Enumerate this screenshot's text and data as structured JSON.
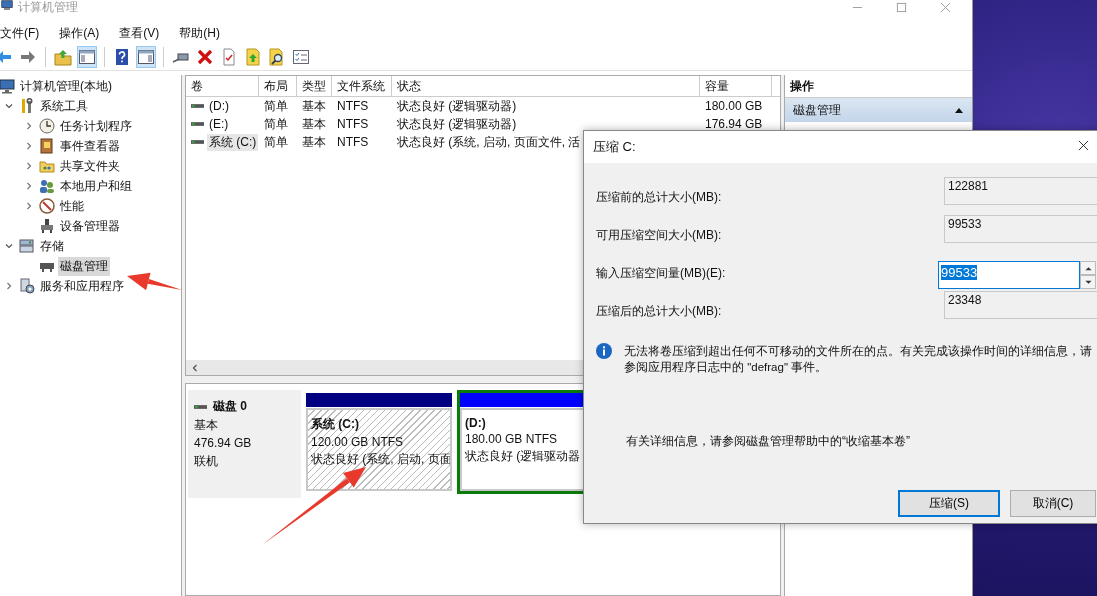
{
  "main_window": {
    "title": "计算机管理"
  },
  "menu": [
    "文件(F)",
    "操作(A)",
    "查看(V)",
    "帮助(H)"
  ],
  "toolbar": [
    {
      "kind": "back",
      "pressed": false
    },
    {
      "kind": "forward",
      "pressed": false
    },
    {
      "kind": "separator"
    },
    {
      "kind": "up",
      "pressed": false
    },
    {
      "kind": "tree-pane",
      "pressed": true
    },
    {
      "kind": "separator"
    },
    {
      "kind": "help",
      "pressed": false
    },
    {
      "kind": "action-pane",
      "pressed": true
    },
    {
      "kind": "separator"
    },
    {
      "kind": "connect",
      "pressed": false
    },
    {
      "kind": "delete",
      "pressed": false
    },
    {
      "kind": "properties",
      "pressed": false
    },
    {
      "kind": "export",
      "pressed": false
    },
    {
      "kind": "find",
      "pressed": false
    },
    {
      "kind": "checklist",
      "pressed": false
    }
  ],
  "tree": [
    {
      "label": "计算机管理(本地)",
      "selected": false,
      "children": [
        {
          "label": "系统工具",
          "expanded": true,
          "selected": false,
          "children": [
            {
              "label": "任务计划程序",
              "expanded": false,
              "selected": false
            },
            {
              "label": "事件查看器",
              "expanded": false,
              "selected": false
            },
            {
              "label": "共享文件夹",
              "expanded": false,
              "selected": false
            },
            {
              "label": "本地用户和组",
              "expanded": false,
              "selected": false
            },
            {
              "label": "性能",
              "expanded": false,
              "selected": false
            },
            {
              "label": "设备管理器",
              "selected": false
            }
          ]
        },
        {
          "label": "存储",
          "expanded": true,
          "selected": false,
          "children": [
            {
              "label": "磁盘管理",
              "selected": true
            }
          ]
        },
        {
          "label": "服务和应用程序",
          "expanded": false,
          "selected": false
        }
      ]
    }
  ],
  "volumes": {
    "columns": [
      "卷",
      "布局",
      "类型",
      "文件系统",
      "状态",
      "容量"
    ],
    "rows": [
      {
        "selected": false,
        "cells": [
          "(D:)",
          "简单",
          "基本",
          "NTFS",
          "状态良好 (逻辑驱动器)",
          "180.00 GB"
        ]
      },
      {
        "selected": false,
        "cells": [
          "(E:)",
          "简单",
          "基本",
          "NTFS",
          "状态良好 (逻辑驱动器)",
          "176.94 GB"
        ]
      },
      {
        "selected": true,
        "cells": [
          "系统 (C:)",
          "简单",
          "基本",
          "NTFS",
          "状态良好 (系统, 启动, 页面文件, 活"
        ]
      }
    ]
  },
  "disk": {
    "name": "磁盘 0",
    "type": "基本",
    "size": "476.94 GB",
    "status": "联机",
    "partitions": [
      {
        "kind": "primary",
        "selected": true,
        "name": "系统 (C:)",
        "size": "120.00 GB NTFS",
        "status": "状态良好 (系统, 启动, 页面"
      },
      {
        "kind": "logical",
        "selected": false,
        "name": "(D:)",
        "size": "180.00 GB NTFS",
        "status": "状态良好 (逻辑驱动器"
      }
    ]
  },
  "actions": {
    "title": "操作",
    "sections": [
      {
        "label": "磁盘管理",
        "expanded": true
      }
    ]
  },
  "dialog": {
    "title": "压缩 C:",
    "fields": [
      {
        "kind": "readonly",
        "label": "压缩前的总计大小(MB):",
        "value": "122881"
      },
      {
        "kind": "readonly",
        "label": "可用压缩空间大小(MB):",
        "value": "99533"
      },
      {
        "kind": "spin",
        "label": "输入压缩空间量(MB)(E):",
        "value": "99533",
        "text_selected": true
      },
      {
        "kind": "readonly",
        "label": "压缩后的总计大小(MB):",
        "value": "23348"
      }
    ],
    "info": "无法将卷压缩到超出任何不可移动的文件所在的点。有关完成该操作时间的详细信息，请参阅应用程序日志中的 \"defrag\" 事件。",
    "hint": "有关详细信息，请参阅磁盘管理帮助中的“收缩基本卷”",
    "buttons": [
      {
        "label": "压缩(S)",
        "default": true
      },
      {
        "label": "取消(C)",
        "default": false
      }
    ]
  }
}
